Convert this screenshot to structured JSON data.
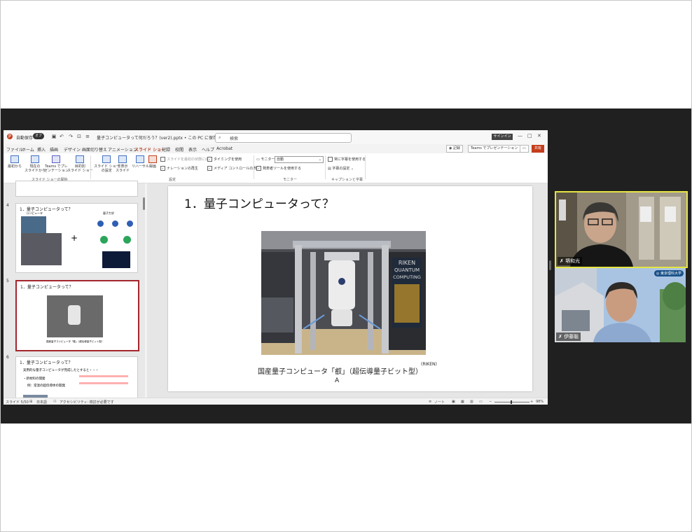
{
  "titlebar": {
    "autosave_label": "自動保存",
    "autosave_state": "オフ",
    "doc_title": "量子コンピュータって何だろう？(ver2).pptx • この PC に保存済み",
    "search_placeholder": "検索",
    "signin_label": "サインイン"
  },
  "tabs": [
    "ファイル",
    "ホーム",
    "挿入",
    "描画",
    "デザイン",
    "画面切り替え",
    "アニメーション",
    "スライド ショー",
    "記録",
    "校閲",
    "表示",
    "ヘルプ",
    "Acrobat"
  ],
  "tab_right": {
    "record": "記録",
    "teams_present": "Teams でプレゼンテーション",
    "share": "共有"
  },
  "ribbon": {
    "from_beginning": "最初から",
    "from_current_1": "現在の",
    "from_current_2": "スライドから",
    "teams_1": "Teams でプレ",
    "teams_2": "ゼンテーション",
    "custom_1": "目的別",
    "custom_2": "スライド ショー",
    "group_start": "スライド ショーの開始",
    "setup_1": "スライド ショー",
    "setup_2": "の設定",
    "hide_1": "非表示",
    "hide_2": "スライド",
    "rehearse": "リハーサル",
    "record": "録画",
    "play_from_start": "スライドを最初の状態に戻す",
    "play_narration": "ナレーションの再生",
    "use_timings": "タイミングを使用",
    "media_controls": "メディア コントロールの表示",
    "group_setup": "設定",
    "monitor_label": "モニター:",
    "monitor_value": "自動",
    "presenter_view": "発表者ツールを使用する",
    "group_monitors": "モニター",
    "always_subtitles": "常に字幕を使用する",
    "subtitle_settings": "字幕の設定",
    "group_captions": "キャプションと字幕"
  },
  "thumbnails": {
    "n4": "4",
    "n5": "5",
    "n6": "6",
    "t4_title": "1．量子コンピュータって？",
    "t4_left_label": "コンピュータ",
    "t4_right_label": "量子力学",
    "t4_plus": "+",
    "t5_title": "1．量子コンピュータって？",
    "t5_caption": "国産量子コンピュータ「叡」（超伝導量子ビット型）",
    "t6_title": "1．量子コンピュータって？",
    "t6_line1": "実用的な量子コンピュータが完成したとすると・・・",
    "t6_line2": "・新材料の開発",
    "t6_line3": "例：常温の超伝導体の開発"
  },
  "slide": {
    "title": "1．量子コンピュータって？",
    "caption": "国産量子コンピュータ「叡」（超伝導量子ビット型）",
    "source": "(RIKEN)",
    "caption_a": "A",
    "photo_sign_1": "RIKEN",
    "photo_sign_2": "QUANTUM",
    "photo_sign_3": "COMPUTING"
  },
  "status": {
    "slide_count": "スライド 5/50",
    "language": "日本語",
    "accessibility": "アクセシビリティ: 検討が必要です",
    "notes": "ノート",
    "zoom": "98%"
  },
  "participants": [
    {
      "name": "堺和光"
    },
    {
      "name": "伊藤聡",
      "badge": "東京理科大学"
    }
  ]
}
